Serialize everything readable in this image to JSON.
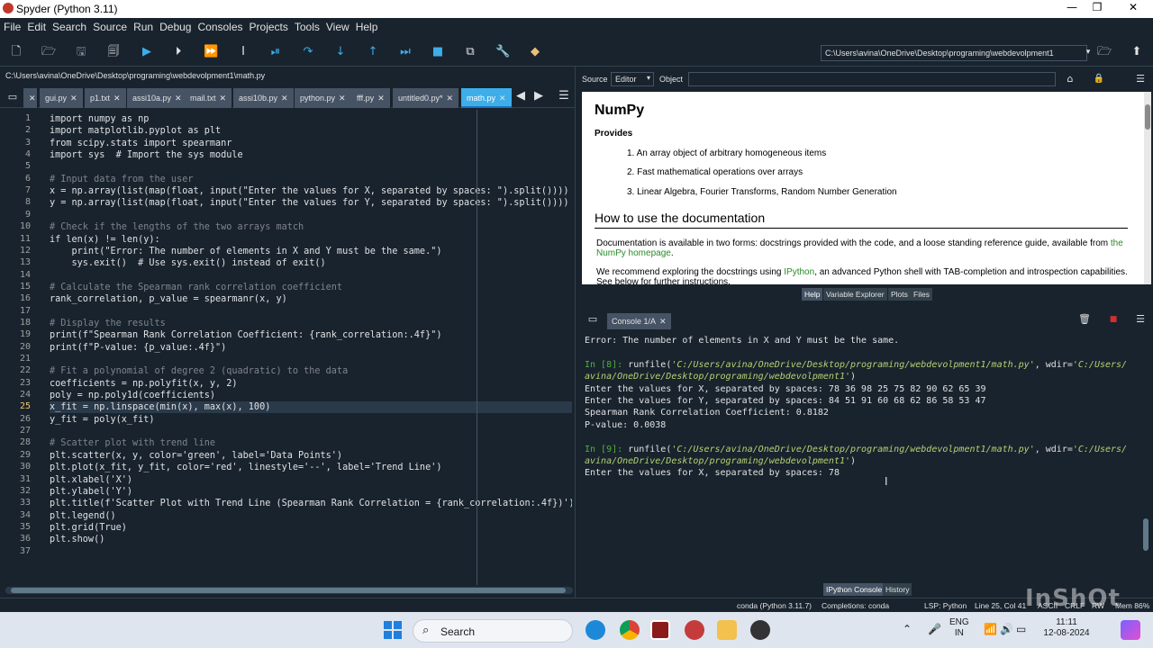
{
  "window": {
    "title": "Spyder (Python 3.11)",
    "minimize": "—",
    "maximize": "❐",
    "close": "✕"
  },
  "menu": [
    "File",
    "Edit",
    "Search",
    "Source",
    "Run",
    "Debug",
    "Consoles",
    "Projects",
    "Tools",
    "View",
    "Help"
  ],
  "toolbar": {
    "working_dir": "C:\\Users\\avina\\OneDrive\\Desktop\\programing\\webdevolpment1",
    "icons": [
      "new-file-icon",
      "open-file-icon",
      "save-icon",
      "save-all-icon",
      "run-icon",
      "run-cell-icon",
      "run-cell-advance-icon",
      "run-selection-icon",
      "debug-icon",
      "debug-step-icon",
      "debug-step-into-icon",
      "debug-step-return-icon",
      "debug-continue-icon",
      "debug-stop-icon",
      "maximize-pane-icon",
      "preferences-icon",
      "python-path-icon",
      "browse-folder-icon",
      "parent-dir-icon"
    ]
  },
  "editor": {
    "filepath": "C:\\Users\\avina\\OneDrive\\Desktop\\programing\\webdevolpment1\\math.py",
    "tabs": [
      {
        "label": "gui.py"
      },
      {
        "label": "p1.txt"
      },
      {
        "label": "assi10a.py"
      },
      {
        "label": "mail.txt"
      },
      {
        "label": "assi10b.py"
      },
      {
        "label": "python.py"
      },
      {
        "label": "fff.py"
      },
      {
        "label": "untitled0.py*"
      },
      {
        "label": "math.py"
      }
    ],
    "active_tab": "math.py",
    "current_line": 25,
    "lines": [
      "import numpy as np",
      "import matplotlib.pyplot as plt",
      "from scipy.stats import spearmanr",
      "import sys  # Import the sys module",
      "",
      "# Input data from the user",
      "x = np.array(list(map(float, input(\"Enter the values for X, separated by spaces: \").split())))",
      "y = np.array(list(map(float, input(\"Enter the values for Y, separated by spaces: \").split())))",
      "",
      "# Check if the lengths of the two arrays match",
      "if len(x) != len(y):",
      "    print(\"Error: The number of elements in X and Y must be the same.\")",
      "    sys.exit()  # Use sys.exit() instead of exit()",
      "",
      "# Calculate the Spearman rank correlation coefficient",
      "rank_correlation, p_value = spearmanr(x, y)",
      "",
      "# Display the results",
      "print(f\"Spearman Rank Correlation Coefficient: {rank_correlation:.4f}\")",
      "print(f\"P-value: {p_value:.4f}\")",
      "",
      "# Fit a polynomial of degree 2 (quadratic) to the data",
      "coefficients = np.polyfit(x, y, 2)",
      "poly = np.poly1d(coefficients)",
      "x_fit = np.linspace(min(x), max(x), 100)",
      "y_fit = poly(x_fit)",
      "",
      "# Scatter plot with trend line",
      "plt.scatter(x, y, color='green', label='Data Points')",
      "plt.plot(x_fit, y_fit, color='red', linestyle='--', label='Trend Line')",
      "plt.xlabel('X')",
      "plt.ylabel('Y')",
      "plt.title(f'Scatter Plot with Trend Line (Spearman Rank Correlation = {rank_correlation:.4f})')",
      "plt.legend()",
      "plt.grid(True)",
      "plt.show()",
      ""
    ]
  },
  "help": {
    "source_label": "Source",
    "source_value": "Editor",
    "object_label": "Object",
    "object_value": "",
    "title": "NumPy",
    "provides": "Provides",
    "items": [
      "1.  An array object of arbitrary homogeneous items",
      "2.  Fast mathematical operations over arrays",
      "3.  Linear Algebra, Fourier Transforms, Random Number Generation"
    ],
    "section": "How to use the documentation",
    "para1": "Documentation is available in two forms: docstrings provided with the code, and a loose standing reference guide, available from ",
    "para1_link": "the NumPy homepage",
    "para1_end": ".",
    "para2_a": "We recommend exploring the docstrings using ",
    "para2_link": "IPython",
    "para2_b": ", an advanced Python shell with TAB-completion and introspection capabilities. See below for further instructions.",
    "tabs": [
      "Help",
      "Variable Explorer",
      "Plots",
      "Files"
    ],
    "active_tab": "Help"
  },
  "console": {
    "tab": "Console 1/A",
    "lines": [
      {
        "t": "plain",
        "text": "Error: The number of elements in X and Y must be the same."
      },
      {
        "t": "blank",
        "text": ""
      },
      {
        "t": "prompt",
        "prompt": "In [8]: ",
        "cmd": "runfile(",
        "arg": "'C:/Users/avina/OneDrive/Desktop/programing/webdevolpment1/math.py'",
        "rest": ", wdir=",
        "arg2": "'C:/Users/"
      },
      {
        "t": "italic",
        "text": "avina/OneDrive/Desktop/programing/webdevolpment1'",
        "tail": ")"
      },
      {
        "t": "plain",
        "text": "Enter the values for X, separated by spaces: 78 36 98 25 75 82 90 62 65 39"
      },
      {
        "t": "plain",
        "text": "Enter the values for Y, separated by spaces: 84 51 91 60 68 62 86 58 53 47"
      },
      {
        "t": "plain",
        "text": "Spearman Rank Correlation Coefficient: 0.8182"
      },
      {
        "t": "plain",
        "text": "P-value: 0.0038"
      },
      {
        "t": "blank",
        "text": ""
      },
      {
        "t": "prompt",
        "prompt": "In [9]: ",
        "cmd": "runfile(",
        "arg": "'C:/Users/avina/OneDrive/Desktop/programing/webdevolpment1/math.py'",
        "rest": ", wdir=",
        "arg2": "'C:/Users/"
      },
      {
        "t": "italic",
        "text": "avina/OneDrive/Desktop/programing/webdevolpment1'",
        "tail": ")"
      },
      {
        "t": "plain",
        "text": "Enter the values for X, separated by spaces: 78"
      }
    ],
    "bottom_tabs": [
      "IPython Console",
      "History"
    ],
    "active_bottom_tab": "IPython Console"
  },
  "status": {
    "env": "conda (Python 3.11.7)",
    "completions": "Completions: conda",
    "lsp": "LSP: Python",
    "position": "Line 25, Col 41",
    "encoding": "ASCII",
    "eol": "CRLF",
    "rw": "RW",
    "mem": "Mem 86%"
  },
  "taskbar": {
    "search": "Search",
    "lang_top": "ENG",
    "lang_bottom": "IN",
    "time": "11:11",
    "date": "12-08-2024"
  },
  "watermark": "InShOt"
}
